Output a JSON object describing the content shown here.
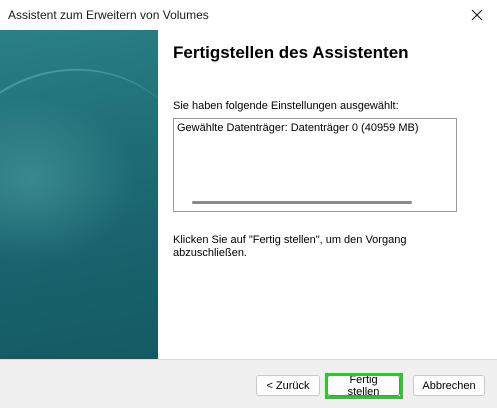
{
  "window": {
    "title": "Assistent zum Erweitern von Volumes",
    "close_icon": "close-icon"
  },
  "content": {
    "heading": "Fertigstellen des Assistenten",
    "summary_label": "Sie haben folgende Einstellungen ausgewählt:",
    "summary_text": "Gewählte Datenträger: Datenträger 0 (40959 MB)",
    "instruction": "Klicken Sie auf \"Fertig stellen\", um den Vorgang abzuschließen."
  },
  "buttons": {
    "back": "< Zurück",
    "finish": "Fertig stellen",
    "cancel": "Abbrechen"
  },
  "colors": {
    "side_panel": "#1f6f78",
    "highlight": "#2fc52f"
  }
}
